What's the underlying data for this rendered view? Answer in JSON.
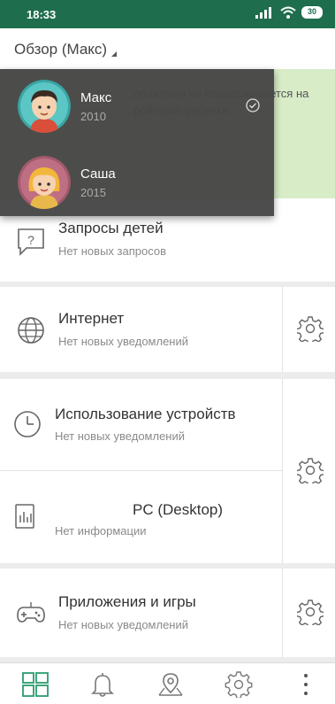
{
  "status_bar": {
    "time": "18:33",
    "battery": "30"
  },
  "header": {
    "title": "Обзор (Макс)"
  },
  "banner": {
    "text": "...оложения не поддерживается на ...ройствах ребенка"
  },
  "children_menu": [
    {
      "name": "Макс",
      "year": "2010",
      "selected": true
    },
    {
      "name": "Саша",
      "year": "2015",
      "selected": false
    }
  ],
  "cards": {
    "requests": {
      "title": "Запросы детей",
      "subtitle": "Нет новых запросов"
    },
    "internet": {
      "title": "Интернет",
      "subtitle": "Нет новых уведомлений"
    },
    "device_usage": {
      "title": "Использование устройств",
      "subtitle": "Нет новых уведомлений"
    },
    "pc": {
      "title": "PC (Desktop)",
      "subtitle": "Нет информации"
    },
    "apps": {
      "title": "Приложения и игры",
      "subtitle": "Нет новых уведомлений"
    }
  },
  "bottom_nav": [
    "dashboard-icon",
    "bell-icon",
    "location-icon",
    "settings-icon",
    "more-icon"
  ],
  "colors": {
    "accent": "#2a9d6e",
    "statusbar": "#1e6e4e",
    "banner": "#d8ecc8",
    "overlay": "#464646"
  }
}
